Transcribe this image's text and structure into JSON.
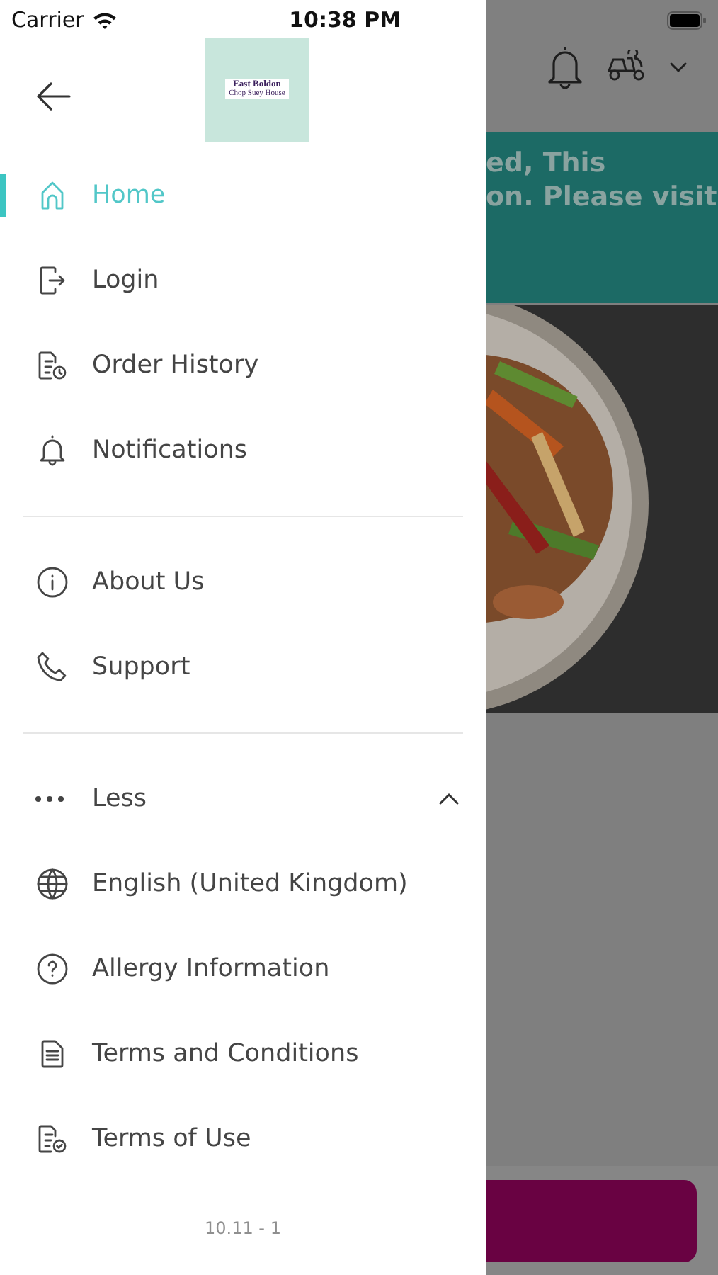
{
  "status_bar": {
    "carrier": "Carrier",
    "time": "10:38 PM"
  },
  "drawer": {
    "logo_lines": [
      "East Boldon",
      "Chop Suey House"
    ],
    "sections": [
      {
        "items": [
          {
            "label": "Home",
            "kind": "home",
            "selected": true
          },
          {
            "label": "Login",
            "kind": "login",
            "selected": false
          },
          {
            "label": "Order History",
            "kind": "history",
            "selected": false
          },
          {
            "label": "Notifications",
            "kind": "bell",
            "selected": false
          }
        ]
      },
      {
        "items": [
          {
            "label": "About Us",
            "kind": "info",
            "selected": false
          },
          {
            "label": "Support",
            "kind": "phone",
            "selected": false
          }
        ]
      }
    ],
    "toggle": {
      "label": "Less",
      "expanded": true
    },
    "more_items": [
      {
        "label": "English (United Kingdom)",
        "kind": "globe",
        "selected": false
      },
      {
        "label": "Allergy Information",
        "kind": "question",
        "selected": false
      },
      {
        "label": "Terms and Conditions",
        "kind": "document",
        "selected": false
      },
      {
        "label": "Terms of Use",
        "kind": "document-check",
        "selected": false
      }
    ],
    "version": "10.11 - 1"
  },
  "background": {
    "banner_lines": [
      "ed, This",
      "on. Please visit"
    ]
  }
}
